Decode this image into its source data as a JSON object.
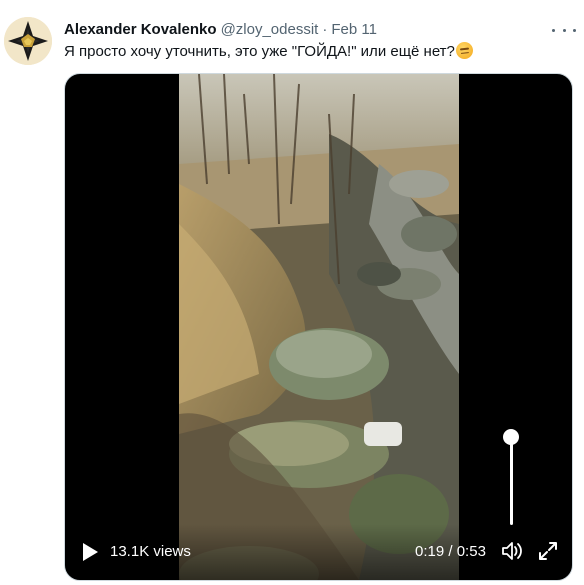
{
  "tweet": {
    "author_name": "Alexander Kovalenko",
    "handle": "@zloy_odessit",
    "separator": "·",
    "date": "Feb 11",
    "text": "Я просто хочу уточнить, это уже \"ГОЙДА!\" или ещё нет?",
    "emoji": "thinking-face-emoji"
  },
  "video": {
    "views": "13.1K views",
    "current_time": "0:19",
    "time_separator": " / ",
    "duration": "0:53",
    "volume_level": 1.0,
    "icons": {
      "play": "play-icon",
      "volume": "volume-icon",
      "fullscreen": "fullscreen-icon",
      "more": "more-icon"
    }
  },
  "colors": {
    "name": "#0f1419",
    "secondary": "#536471",
    "media_border": "#cfd9de",
    "video_bg": "#000000"
  }
}
